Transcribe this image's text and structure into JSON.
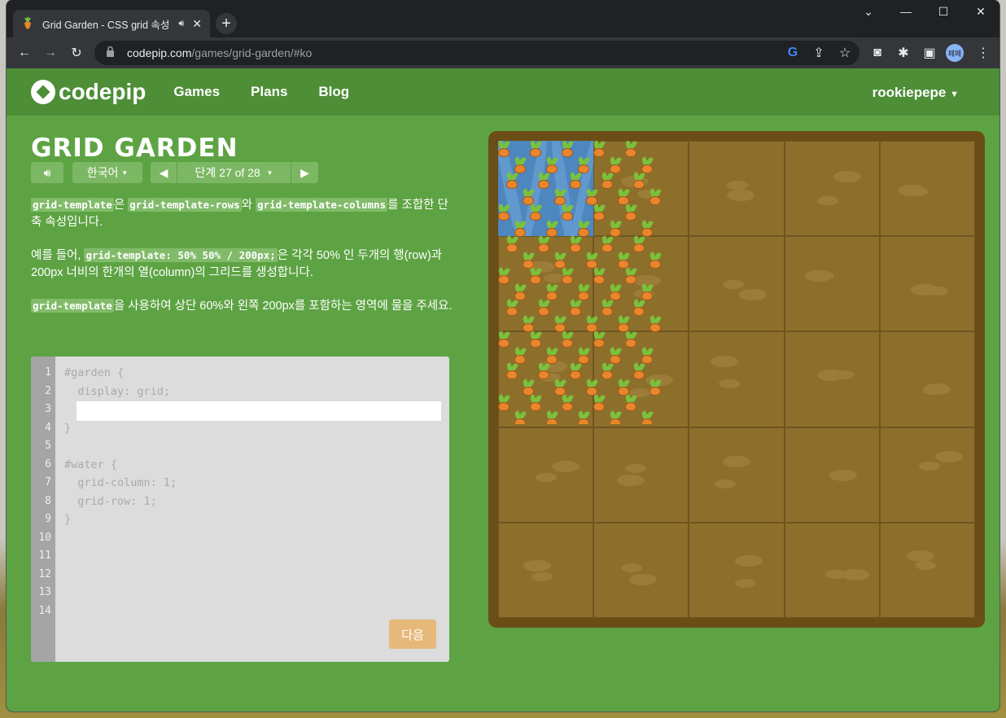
{
  "browser": {
    "tab_title": "Grid Garden - CSS grid 속성",
    "tab_audio_icon": "speaker-icon",
    "url_host": "codepip.com",
    "url_path": "/games/grid-garden/#ko",
    "profile_label": "페페"
  },
  "nav": {
    "brand": "codepip",
    "links": [
      "Games",
      "Plans",
      "Blog"
    ],
    "user": "rookiepepe"
  },
  "game": {
    "title": "GRID GARDEN",
    "language": "한국어",
    "level_label": "단계 27 of 28",
    "instructions": {
      "p1_code1": "grid-template",
      "p1_t1": "은 ",
      "p1_code2": "grid-template-rows",
      "p1_t2": "와 ",
      "p1_code3": "grid-template-columns",
      "p1_t3": "를 조합한 단축 속성입니다.",
      "p2_t1": "예를 들어, ",
      "p2_code1": "grid-template: 50% 50% / 200px;",
      "p2_t2": "은 각각 50% 인 두개의 행(row)과 200px 너비의 한개의 열(column)의 그리드를 생성합니다.",
      "p3_code1": "grid-template",
      "p3_t1": "을 사용하여 상단 60%와 왼쪽 200px를 포함하는 영역에 물을 주세요."
    },
    "editor": {
      "line_numbers": [
        "1",
        "2",
        "3",
        "4",
        "5",
        "6",
        "7",
        "8",
        "9",
        "10",
        "11",
        "12",
        "13",
        "14"
      ],
      "lines": [
        "#garden {",
        "  display: grid;",
        "",
        "}",
        "",
        "#water {",
        "  grid-column: 1;",
        "  grid-row: 1;",
        "}"
      ],
      "input_value": "",
      "next_label": "다음"
    }
  },
  "colors": {
    "page_bg": "#5da343",
    "nav_bg": "#4d8e37",
    "garden_border": "#6b4e15",
    "soil": "#8d6f2c",
    "water": "#4e86be",
    "carrot": "#e8862c"
  }
}
